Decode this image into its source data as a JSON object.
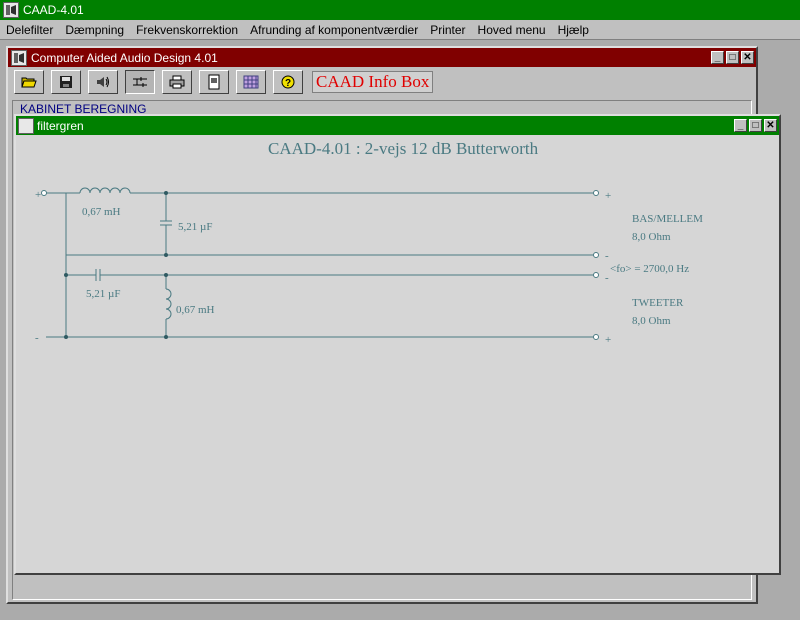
{
  "app": {
    "title": "CAAD-4.01"
  },
  "menu": [
    "Delefilter",
    "Dæmpning",
    "Frekvenskorrektion",
    "Afrunding af komponentværdier",
    "Printer",
    "Hoved menu",
    "Hjælp"
  ],
  "main_window": {
    "title": "Computer Aided Audio Design 4.01",
    "toolbar": [
      "open-folder-icon",
      "save-icon",
      "speaker-icon",
      "filter-icon",
      "printer-icon",
      "document-icon",
      "grid-icon",
      "help-icon"
    ],
    "info_box": "CAAD Info Box",
    "section_label": "KABINET BEREGNING"
  },
  "filter_window": {
    "title": "filtergren",
    "heading": "CAAD-4.01 : 2-vejs 12 dB Butterworth",
    "components": {
      "l1": "0,67 mH",
      "c1": "5,21 µF",
      "c2": "5,21 µF",
      "l2": "0,67 mH"
    },
    "terminals": {
      "plus": "+",
      "minus": "-"
    },
    "outputs": {
      "bass_name": "BAS/MELLEM",
      "bass_impedance": "8,0 Ohm",
      "crossover": "<fo> = 2700,0 Hz",
      "tweeter_name": "TWEETER",
      "tweeter_impedance": "8,0 Ohm"
    }
  },
  "colors": {
    "main_titlebar": "#008000",
    "child_titlebar": "#800000",
    "circuit_ink": "#4a7a82",
    "info_text": "#e00000"
  }
}
